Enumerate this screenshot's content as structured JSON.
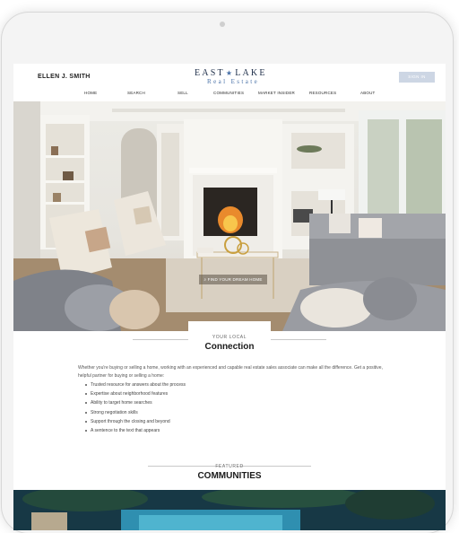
{
  "header": {
    "agent_name": "ELLEN J. SMITH",
    "logo_left": "EAST",
    "logo_star": "★",
    "logo_right": "LAKE",
    "logo_sub": "Real Estate",
    "signin_label": "SIGN IN"
  },
  "nav": {
    "items": [
      "HOME",
      "SEARCH",
      "SELL",
      "COMMUNITIES",
      "MARKET INSIDER",
      "RESOURCES",
      "ABOUT"
    ]
  },
  "hero": {
    "search_label": "FIND YOUR DREAM HOME"
  },
  "connection": {
    "kicker": "YOUR LOCAL",
    "title": "Connection",
    "intro": "Whether you're buying or selling a home, working with an experienced and capable real estate sales associate can make all the difference.  Get a positive, helpful partner for buying or selling a home:",
    "bullets": [
      "Trusted resource for answers about the process",
      "Expertise about neighborhood features",
      "Ability to target home searches",
      "Strong negotiation skills",
      "Support through the closing and beyond",
      "A sentence to the text that appears"
    ]
  },
  "communities": {
    "kicker": "FEATURED",
    "title": "COMMUNITIES"
  },
  "colors": {
    "brand_navy": "#1f2f4a",
    "brand_blue": "#4a72a8",
    "signin_bg": "#cdd6e4"
  }
}
